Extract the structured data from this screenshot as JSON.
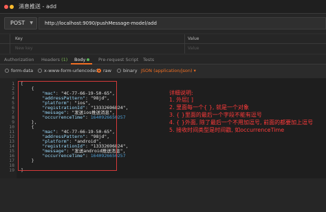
{
  "window": {
    "title": "消息推送 - add",
    "colors": {
      "close": "#ff5f57",
      "min": "#febc2e",
      "max": "#28c840",
      "accent": "#f47023",
      "annotation": "#ff3b3b"
    }
  },
  "request": {
    "method": "POST",
    "url": "http://localhost:9090/pushMessage-model/add"
  },
  "params": {
    "key_header": "Key",
    "value_header": "Value",
    "key_placeholder": "New key",
    "value_placeholder": "Value"
  },
  "tabs": [
    {
      "label": "Authorization"
    },
    {
      "label": "Headers",
      "count": "(1)"
    },
    {
      "label": "Body",
      "active": true
    },
    {
      "label": "Pre-request Script"
    },
    {
      "label": "Tests"
    }
  ],
  "body_types": {
    "options": [
      "form-data",
      "x-www-form-urlencoded",
      "raw",
      "binary"
    ],
    "selected": "raw",
    "format": "JSON (application/json)"
  },
  "editor": {
    "line_numbers": [
      "1",
      "2",
      "3",
      "4",
      "5",
      "6",
      "7",
      "8",
      "9",
      "10",
      "11",
      "12",
      "13",
      "14",
      "15",
      "16",
      "17",
      "18",
      "19"
    ],
    "lines": [
      "[",
      "    {",
      "        \"mac\": \"4C-77-66-19-50-65\",",
      "        \"addressPattern\": \"98jd\",",
      "        \"platform\": \"ios\",",
      "        \"registrationId\": \"13332696824\",",
      "        \"message\": \"发送ios推送消息\",",
      "        \"occurrenceTime\": 1640926650257",
      "    },",
      "    {",
      "        \"mac\": \"4C-77-66-19-50-65\",",
      "        \"addressPattern\": \"98jd\",",
      "        \"platform\": \"android\",",
      "        \"registrationId\": \"13332696824\",",
      "        \"message\": \"发送android推送消息\",",
      "        \"occurrenceTime\": 1640926650257",
      "    }",
      "",
      "]"
    ]
  },
  "annotation": {
    "lines": [
      "详细说明:",
      "1. 外层[ ]",
      "2. 里面每一个{ }, 就是一个对象",
      "3. { }里面的最后一个字段不能有逗号",
      "4. { }外面, 除了最后一个不用加逗号, 前面的都要加上逗号",
      "5. 接收时间类型是时间戳, 如occurrenceTime"
    ]
  }
}
